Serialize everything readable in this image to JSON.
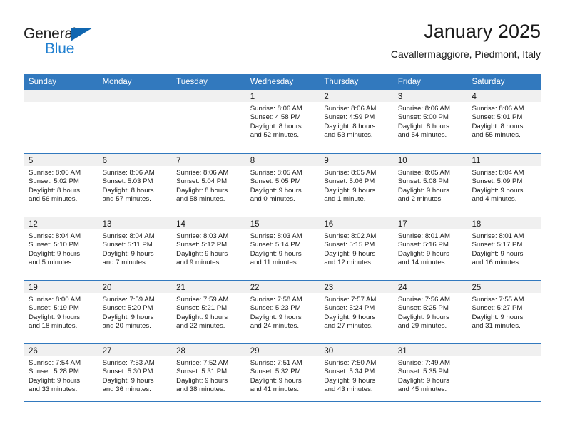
{
  "brand": {
    "name_part1": "General",
    "name_part2": "Blue",
    "triangle_color": "#1066b0",
    "blue_color": "#1f7fd0"
  },
  "header": {
    "title": "January 2025",
    "subtitle": "Cavallermaggiore, Piedmont, Italy"
  },
  "theme": {
    "header_blue": "#3279be",
    "day_band_gray": "#f0f0f0",
    "text_color": "#1a1a1a"
  },
  "weekdays": [
    "Sunday",
    "Monday",
    "Tuesday",
    "Wednesday",
    "Thursday",
    "Friday",
    "Saturday"
  ],
  "weeks": [
    [
      {
        "num": "",
        "lines": [],
        "empty": true
      },
      {
        "num": "",
        "lines": [],
        "empty": true
      },
      {
        "num": "",
        "lines": [],
        "empty": true
      },
      {
        "num": "1",
        "lines": [
          "Sunrise: 8:06 AM",
          "Sunset: 4:58 PM",
          "Daylight: 8 hours",
          "and 52 minutes."
        ]
      },
      {
        "num": "2",
        "lines": [
          "Sunrise: 8:06 AM",
          "Sunset: 4:59 PM",
          "Daylight: 8 hours",
          "and 53 minutes."
        ]
      },
      {
        "num": "3",
        "lines": [
          "Sunrise: 8:06 AM",
          "Sunset: 5:00 PM",
          "Daylight: 8 hours",
          "and 54 minutes."
        ]
      },
      {
        "num": "4",
        "lines": [
          "Sunrise: 8:06 AM",
          "Sunset: 5:01 PM",
          "Daylight: 8 hours",
          "and 55 minutes."
        ]
      }
    ],
    [
      {
        "num": "5",
        "lines": [
          "Sunrise: 8:06 AM",
          "Sunset: 5:02 PM",
          "Daylight: 8 hours",
          "and 56 minutes."
        ]
      },
      {
        "num": "6",
        "lines": [
          "Sunrise: 8:06 AM",
          "Sunset: 5:03 PM",
          "Daylight: 8 hours",
          "and 57 minutes."
        ]
      },
      {
        "num": "7",
        "lines": [
          "Sunrise: 8:06 AM",
          "Sunset: 5:04 PM",
          "Daylight: 8 hours",
          "and 58 minutes."
        ]
      },
      {
        "num": "8",
        "lines": [
          "Sunrise: 8:05 AM",
          "Sunset: 5:05 PM",
          "Daylight: 9 hours",
          "and 0 minutes."
        ]
      },
      {
        "num": "9",
        "lines": [
          "Sunrise: 8:05 AM",
          "Sunset: 5:06 PM",
          "Daylight: 9 hours",
          "and 1 minute."
        ]
      },
      {
        "num": "10",
        "lines": [
          "Sunrise: 8:05 AM",
          "Sunset: 5:08 PM",
          "Daylight: 9 hours",
          "and 2 minutes."
        ]
      },
      {
        "num": "11",
        "lines": [
          "Sunrise: 8:04 AM",
          "Sunset: 5:09 PM",
          "Daylight: 9 hours",
          "and 4 minutes."
        ]
      }
    ],
    [
      {
        "num": "12",
        "lines": [
          "Sunrise: 8:04 AM",
          "Sunset: 5:10 PM",
          "Daylight: 9 hours",
          "and 5 minutes."
        ]
      },
      {
        "num": "13",
        "lines": [
          "Sunrise: 8:04 AM",
          "Sunset: 5:11 PM",
          "Daylight: 9 hours",
          "and 7 minutes."
        ]
      },
      {
        "num": "14",
        "lines": [
          "Sunrise: 8:03 AM",
          "Sunset: 5:12 PM",
          "Daylight: 9 hours",
          "and 9 minutes."
        ]
      },
      {
        "num": "15",
        "lines": [
          "Sunrise: 8:03 AM",
          "Sunset: 5:14 PM",
          "Daylight: 9 hours",
          "and 11 minutes."
        ]
      },
      {
        "num": "16",
        "lines": [
          "Sunrise: 8:02 AM",
          "Sunset: 5:15 PM",
          "Daylight: 9 hours",
          "and 12 minutes."
        ]
      },
      {
        "num": "17",
        "lines": [
          "Sunrise: 8:01 AM",
          "Sunset: 5:16 PM",
          "Daylight: 9 hours",
          "and 14 minutes."
        ]
      },
      {
        "num": "18",
        "lines": [
          "Sunrise: 8:01 AM",
          "Sunset: 5:17 PM",
          "Daylight: 9 hours",
          "and 16 minutes."
        ]
      }
    ],
    [
      {
        "num": "19",
        "lines": [
          "Sunrise: 8:00 AM",
          "Sunset: 5:19 PM",
          "Daylight: 9 hours",
          "and 18 minutes."
        ]
      },
      {
        "num": "20",
        "lines": [
          "Sunrise: 7:59 AM",
          "Sunset: 5:20 PM",
          "Daylight: 9 hours",
          "and 20 minutes."
        ]
      },
      {
        "num": "21",
        "lines": [
          "Sunrise: 7:59 AM",
          "Sunset: 5:21 PM",
          "Daylight: 9 hours",
          "and 22 minutes."
        ]
      },
      {
        "num": "22",
        "lines": [
          "Sunrise: 7:58 AM",
          "Sunset: 5:23 PM",
          "Daylight: 9 hours",
          "and 24 minutes."
        ]
      },
      {
        "num": "23",
        "lines": [
          "Sunrise: 7:57 AM",
          "Sunset: 5:24 PM",
          "Daylight: 9 hours",
          "and 27 minutes."
        ]
      },
      {
        "num": "24",
        "lines": [
          "Sunrise: 7:56 AM",
          "Sunset: 5:25 PM",
          "Daylight: 9 hours",
          "and 29 minutes."
        ]
      },
      {
        "num": "25",
        "lines": [
          "Sunrise: 7:55 AM",
          "Sunset: 5:27 PM",
          "Daylight: 9 hours",
          "and 31 minutes."
        ]
      }
    ],
    [
      {
        "num": "26",
        "lines": [
          "Sunrise: 7:54 AM",
          "Sunset: 5:28 PM",
          "Daylight: 9 hours",
          "and 33 minutes."
        ]
      },
      {
        "num": "27",
        "lines": [
          "Sunrise: 7:53 AM",
          "Sunset: 5:30 PM",
          "Daylight: 9 hours",
          "and 36 minutes."
        ]
      },
      {
        "num": "28",
        "lines": [
          "Sunrise: 7:52 AM",
          "Sunset: 5:31 PM",
          "Daylight: 9 hours",
          "and 38 minutes."
        ]
      },
      {
        "num": "29",
        "lines": [
          "Sunrise: 7:51 AM",
          "Sunset: 5:32 PM",
          "Daylight: 9 hours",
          "and 41 minutes."
        ]
      },
      {
        "num": "30",
        "lines": [
          "Sunrise: 7:50 AM",
          "Sunset: 5:34 PM",
          "Daylight: 9 hours",
          "and 43 minutes."
        ]
      },
      {
        "num": "31",
        "lines": [
          "Sunrise: 7:49 AM",
          "Sunset: 5:35 PM",
          "Daylight: 9 hours",
          "and 45 minutes."
        ]
      },
      {
        "num": "",
        "lines": [],
        "empty": true
      }
    ]
  ]
}
